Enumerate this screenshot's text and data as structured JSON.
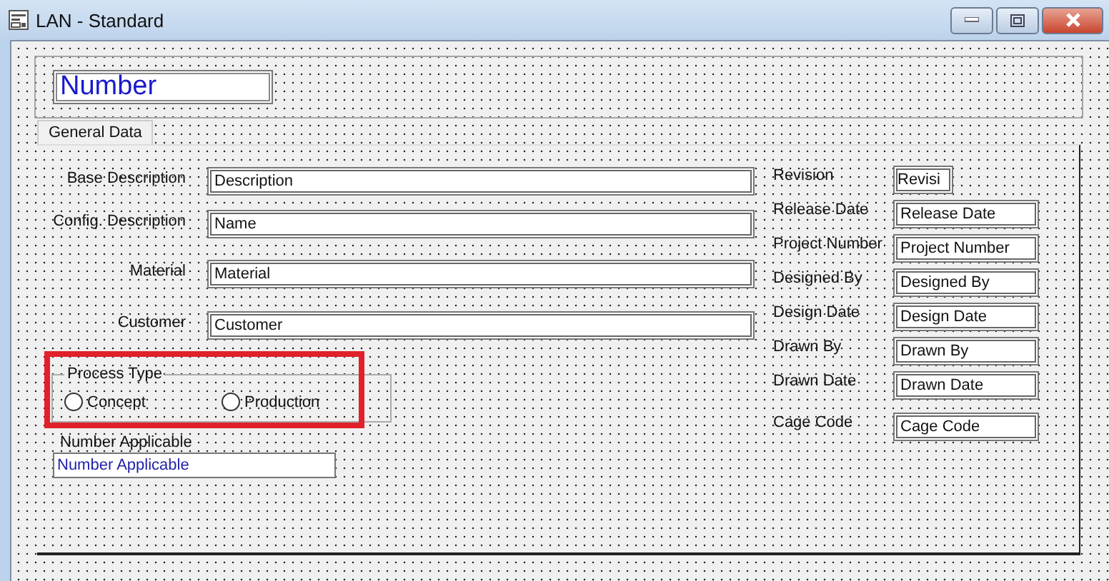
{
  "window": {
    "title": "LAN - Standard"
  },
  "header": {
    "number_field": {
      "value": "Number"
    }
  },
  "tabs": [
    {
      "label": "General Data",
      "selected": true
    }
  ],
  "left_fields": [
    {
      "label": "Base Description",
      "value": "Description"
    },
    {
      "label": "Config. Description",
      "value": "Name"
    },
    {
      "label": "Material",
      "value": "Material"
    },
    {
      "label": "Customer",
      "value": "Customer"
    }
  ],
  "process_type": {
    "title": "Process Type",
    "options": [
      {
        "label": "Concept",
        "selected": false
      },
      {
        "label": "Production",
        "selected": false
      }
    ]
  },
  "number_applicable": {
    "label": "Number Applicable",
    "value": "Number Applicable"
  },
  "right_fields": [
    {
      "label": "Revision",
      "value": "Revisi",
      "kind": "short"
    },
    {
      "label": "Release Date",
      "value": "Release Date",
      "kind": "wide"
    },
    {
      "label": "Project Number",
      "value": "Project Number",
      "kind": "wide"
    },
    {
      "label": "Designed By",
      "value": "Designed By",
      "kind": "wide"
    },
    {
      "label": "Design Date",
      "value": "Design Date",
      "kind": "wide"
    },
    {
      "label": "Drawn By",
      "value": "Drawn By",
      "kind": "wide"
    },
    {
      "label": "Drawn Date",
      "value": "Drawn Date",
      "kind": "wide"
    },
    {
      "label": "Cage Code",
      "value": "Cage Code",
      "kind": "wide"
    }
  ]
}
